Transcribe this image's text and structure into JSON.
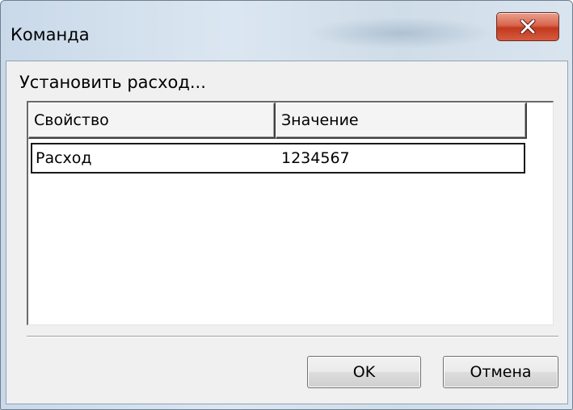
{
  "window": {
    "title": "Команда"
  },
  "dialog": {
    "prompt": "Установить расход..."
  },
  "table": {
    "columns": [
      "Свойство",
      "Значение"
    ],
    "rows": [
      {
        "property": "Расход",
        "value": "1234567"
      }
    ]
  },
  "buttons": {
    "ok_label": "OK",
    "cancel_label": "Отмена"
  },
  "icons": {
    "close": "close-icon"
  },
  "colors": {
    "close_button": "#c2391f",
    "frame": "#cfdde9",
    "client_bg": "#f0f0f0"
  }
}
